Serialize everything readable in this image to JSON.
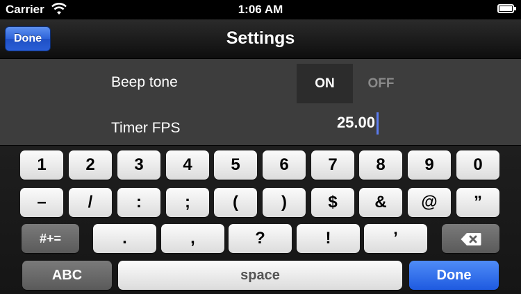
{
  "status_bar": {
    "carrier": "Carrier",
    "time": "1:06 AM",
    "wifi_icon": "wifi-icon",
    "battery_icon": "battery-full-icon"
  },
  "nav": {
    "title": "Settings",
    "done_label": "Done"
  },
  "settings": {
    "beep_tone": {
      "label": "Beep tone",
      "on_label": "ON",
      "off_label": "OFF",
      "selected": "ON"
    },
    "timer_fps": {
      "label": "Timer FPS",
      "value": "25.00"
    }
  },
  "keyboard": {
    "row1": [
      "1",
      "2",
      "3",
      "4",
      "5",
      "6",
      "7",
      "8",
      "9",
      "0"
    ],
    "row2": [
      "–",
      "/",
      ":",
      ";",
      "(",
      ")",
      "$",
      "&",
      "@",
      "”"
    ],
    "row3": {
      "symbols_label": "#+=",
      "keys": [
        ".",
        ",",
        "?",
        "!",
        "’"
      ],
      "delete_icon": "backspace-icon"
    },
    "row4": {
      "abc_label": "ABC",
      "space_label": "space",
      "done_label": "Done"
    }
  },
  "colors": {
    "nav_done_blue": "#2d63d9",
    "keyboard_done_blue": "#1e5ae0",
    "cursor_blue": "#5b7cf0",
    "background": "#3d3d3d"
  }
}
